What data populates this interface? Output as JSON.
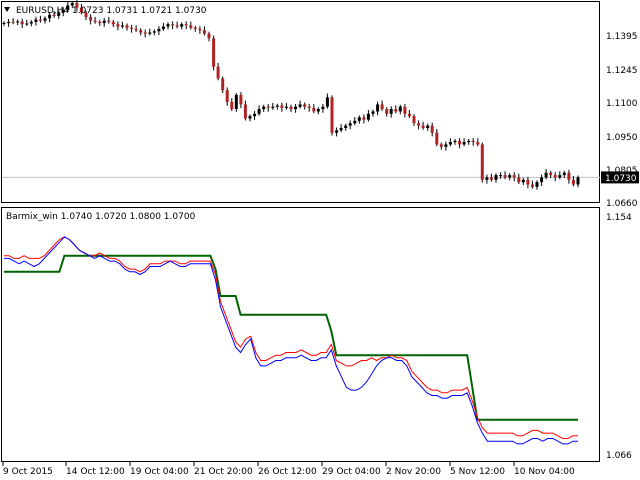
{
  "colors": {
    "background": "#ffffff",
    "frame": "#000000",
    "candle": "#000000",
    "candle_bear": "#b22222",
    "price_line": "#c0c0c0",
    "price_tag_bg": "#000000",
    "price_tag_text": "#ffffff",
    "line1": "#0000ff",
    "line2": "#ff0000",
    "line3": "#006400"
  },
  "chart_data": [
    {
      "type": "candlestick",
      "title": "EURUSD,H4  1.0723 1.0731 1.0721 1.0730",
      "title_icon": "triangle-down-icon",
      "ylim": [
        1.063,
        1.147
      ],
      "y_ticks": [
        "1.1395",
        "1.1245",
        "1.1100",
        "1.0950",
        "1.0805",
        "1.0660"
      ],
      "current_price": 1.073,
      "current_price_label": "1.0730",
      "close_series": [
        1.1385,
        1.139,
        1.1388,
        1.1392,
        1.138,
        1.1383,
        1.139,
        1.14,
        1.1395,
        1.1405,
        1.142,
        1.1415,
        1.143,
        1.144,
        1.146,
        1.147,
        1.145,
        1.143,
        1.141,
        1.1395,
        1.139,
        1.1385,
        1.1395,
        1.139,
        1.138,
        1.137,
        1.1375,
        1.1365,
        1.136,
        1.1355,
        1.1345,
        1.134,
        1.1345,
        1.135,
        1.136,
        1.137,
        1.138,
        1.1375,
        1.137,
        1.138,
        1.1375,
        1.1365,
        1.136,
        1.1355,
        1.134,
        1.132,
        1.12,
        1.115,
        1.11,
        1.105,
        1.102,
        1.108,
        1.104,
        1.098,
        1.099,
        1.1,
        1.102,
        1.103,
        1.1025,
        1.103,
        1.1035,
        1.1025,
        1.103,
        1.102,
        1.103,
        1.104,
        1.103,
        1.1025,
        1.101,
        1.102,
        1.103,
        1.107,
        1.092,
        1.093,
        1.094,
        1.095,
        1.096,
        1.097,
        1.0985,
        1.0975,
        1.1,
        1.101,
        1.104,
        1.102,
        1.1,
        1.102,
        1.101,
        1.103,
        1.1,
        1.099,
        1.096,
        1.095,
        1.094,
        1.095,
        1.092,
        1.087,
        1.086,
        1.087,
        1.088,
        1.0885,
        1.087,
        1.088,
        1.0885,
        1.088,
        1.087,
        1.072,
        1.073,
        1.072,
        1.074,
        1.074,
        1.073,
        1.074,
        1.073,
        1.071,
        1.072,
        1.07,
        1.069,
        1.071,
        1.073,
        1.075,
        1.074,
        1.073,
        1.074,
        1.075,
        1.072,
        1.07,
        1.073
      ]
    },
    {
      "type": "line",
      "title": "Barmix_win 1.0740 1.0720 1.0800 1.0700",
      "ylim": [
        1.063,
        1.156
      ],
      "y_ticks": [
        "1.154",
        "1.066"
      ],
      "series": [
        {
          "key": "line1",
          "values": [
            1.138,
            1.138,
            1.137,
            1.136,
            1.137,
            1.136,
            1.135,
            1.136,
            1.138,
            1.14,
            1.142,
            1.144,
            1.146,
            1.145,
            1.143,
            1.141,
            1.14,
            1.139,
            1.138,
            1.139,
            1.138,
            1.137,
            1.137,
            1.136,
            1.134,
            1.133,
            1.133,
            1.132,
            1.133,
            1.135,
            1.135,
            1.135,
            1.136,
            1.137,
            1.136,
            1.135,
            1.135,
            1.136,
            1.136,
            1.136,
            1.136,
            1.136,
            1.13,
            1.12,
            1.115,
            1.11,
            1.105,
            1.103,
            1.106,
            1.108,
            1.101,
            1.098,
            1.098,
            1.099,
            1.1,
            1.1,
            1.101,
            1.101,
            1.101,
            1.102,
            1.101,
            1.1,
            1.1,
            1.101,
            1.101,
            1.104,
            1.098,
            1.094,
            1.09,
            1.089,
            1.089,
            1.09,
            1.092,
            1.095,
            1.098,
            1.1,
            1.101,
            1.101,
            1.1,
            1.1,
            1.098,
            1.094,
            1.092,
            1.09,
            1.088,
            1.087,
            1.087,
            1.086,
            1.086,
            1.087,
            1.087,
            1.087,
            1.088,
            1.083,
            1.077,
            1.073,
            1.07,
            1.07,
            1.07,
            1.07,
            1.07,
            1.07,
            1.069,
            1.069,
            1.07,
            1.071,
            1.071,
            1.07,
            1.071,
            1.071,
            1.07,
            1.069,
            1.069,
            1.07,
            1.07
          ]
        },
        {
          "key": "line2",
          "values": [
            1.139,
            1.139,
            1.138,
            1.138,
            1.139,
            1.138,
            1.138,
            1.138,
            1.139,
            1.141,
            1.143,
            1.145,
            1.146,
            1.145,
            1.143,
            1.141,
            1.14,
            1.139,
            1.139,
            1.14,
            1.139,
            1.138,
            1.138,
            1.137,
            1.135,
            1.134,
            1.134,
            1.133,
            1.134,
            1.136,
            1.136,
            1.136,
            1.137,
            1.137,
            1.137,
            1.136,
            1.136,
            1.137,
            1.137,
            1.137,
            1.137,
            1.137,
            1.132,
            1.122,
            1.117,
            1.112,
            1.107,
            1.105,
            1.108,
            1.109,
            1.103,
            1.1,
            1.1,
            1.101,
            1.102,
            1.102,
            1.103,
            1.103,
            1.103,
            1.104,
            1.103,
            1.102,
            1.102,
            1.103,
            1.103,
            1.106,
            1.1,
            1.099,
            1.098,
            1.098,
            1.099,
            1.1,
            1.1,
            1.101,
            1.1,
            1.101,
            1.101,
            1.102,
            1.101,
            1.101,
            1.1,
            1.096,
            1.094,
            1.092,
            1.09,
            1.089,
            1.089,
            1.088,
            1.088,
            1.089,
            1.089,
            1.089,
            1.09,
            1.085,
            1.079,
            1.075,
            1.073,
            1.073,
            1.073,
            1.073,
            1.073,
            1.073,
            1.072,
            1.072,
            1.073,
            1.074,
            1.074,
            1.073,
            1.073,
            1.073,
            1.072,
            1.071,
            1.071,
            1.072,
            1.072
          ]
        },
        {
          "key": "line3",
          "values": [
            1.133,
            1.133,
            1.133,
            1.133,
            1.133,
            1.133,
            1.133,
            1.133,
            1.133,
            1.133,
            1.133,
            1.133,
            1.139,
            1.139,
            1.139,
            1.139,
            1.139,
            1.139,
            1.139,
            1.139,
            1.139,
            1.139,
            1.139,
            1.139,
            1.139,
            1.139,
            1.139,
            1.139,
            1.139,
            1.139,
            1.139,
            1.139,
            1.139,
            1.139,
            1.139,
            1.139,
            1.139,
            1.139,
            1.139,
            1.139,
            1.139,
            1.139,
            1.134,
            1.124,
            1.124,
            1.124,
            1.124,
            1.117,
            1.117,
            1.117,
            1.117,
            1.117,
            1.117,
            1.117,
            1.117,
            1.117,
            1.117,
            1.117,
            1.117,
            1.117,
            1.117,
            1.117,
            1.117,
            1.117,
            1.117,
            1.111,
            1.102,
            1.102,
            1.102,
            1.102,
            1.102,
            1.102,
            1.102,
            1.102,
            1.102,
            1.102,
            1.102,
            1.102,
            1.102,
            1.102,
            1.102,
            1.102,
            1.102,
            1.102,
            1.102,
            1.102,
            1.102,
            1.102,
            1.102,
            1.102,
            1.102,
            1.102,
            1.102,
            1.09,
            1.078,
            1.078,
            1.078,
            1.078,
            1.078,
            1.078,
            1.078,
            1.078,
            1.078,
            1.078,
            1.078,
            1.078,
            1.078,
            1.078,
            1.078,
            1.078,
            1.078,
            1.078,
            1.078,
            1.078,
            1.078
          ]
        }
      ],
      "x_ticks": [
        "9 Oct 2015",
        "14 Oct 12:00",
        "19 Oct 04:00",
        "21 Oct 20:00",
        "26 Oct 12:00",
        "29 Oct 04:00",
        "2 Nov 20:00",
        "5 Nov 12:00",
        "10 Nov 04:00"
      ]
    }
  ]
}
